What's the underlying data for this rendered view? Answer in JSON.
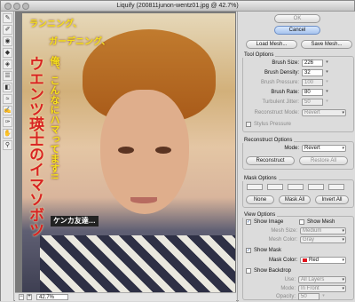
{
  "window": {
    "title": "Liquify (200811junon-wentz01.jpg @ 42.7%)"
  },
  "tools": [
    {
      "icon": "forward-warp-icon",
      "glyph": "✎"
    },
    {
      "icon": "reconstruct-icon",
      "glyph": "✐"
    },
    {
      "icon": "twirl-clockwise-icon",
      "glyph": "◉"
    },
    {
      "icon": "pucker-icon",
      "glyph": "◆"
    },
    {
      "icon": "bloat-icon",
      "glyph": "◈"
    },
    {
      "icon": "push-left-icon",
      "glyph": "☰"
    },
    {
      "icon": "mirror-icon",
      "glyph": "◧"
    },
    {
      "icon": "turbulence-icon",
      "glyph": "≈"
    },
    {
      "icon": "freeze-mask-icon",
      "glyph": "✍"
    },
    {
      "icon": "thaw-mask-icon",
      "glyph": "✑"
    },
    {
      "icon": "hand-icon",
      "glyph": "✋"
    },
    {
      "icon": "zoom-icon",
      "glyph": "⚲"
    }
  ],
  "canvas": {
    "zoom_minus": "−",
    "zoom_plus": "+",
    "zoom_value": "42.7%",
    "overlay_texts": [
      "ランニング、",
      "ガーデニング、",
      "俺、こんなにハマってます!!",
      "ウエンツ瑛士のイマソボツ",
      "ケンカ友達…"
    ]
  },
  "panel": {
    "ok": "OK",
    "cancel": "Cancel",
    "load_mesh": "Load Mesh...",
    "save_mesh": "Save Mesh...",
    "tool_options": {
      "title": "Tool Options",
      "brush_size_label": "Brush Size:",
      "brush_size": "226",
      "brush_density_label": "Brush Density:",
      "brush_density": "32",
      "brush_pressure_label": "Brush Pressure:",
      "brush_pressure": "100",
      "brush_rate_label": "Brush Rate:",
      "brush_rate": "80",
      "turbulent_jitter_label": "Turbulent Jitter:",
      "turbulent_jitter": "50",
      "reconstruct_mode_label": "Reconstruct Mode:",
      "reconstruct_mode": "Revert",
      "stylus_pressure": "Stylus Pressure"
    },
    "reconstruct_options": {
      "title": "Reconstruct Options",
      "mode_label": "Mode:",
      "mode": "Revert",
      "reconstruct": "Reconstruct",
      "restore_all": "Restore All"
    },
    "mask_options": {
      "title": "Mask Options",
      "none": "None",
      "mask_all": "Mask All",
      "invert_all": "Invert All"
    },
    "view_options": {
      "title": "View Options",
      "show_image": "Show Image",
      "show_mesh": "Show Mesh",
      "mesh_size_label": "Mesh Size:",
      "mesh_size": "Medium",
      "mesh_color_label": "Mesh Color:",
      "mesh_color": "Gray",
      "show_mask": "Show Mask",
      "mask_color_label": "Mask Color:",
      "mask_color": "Red",
      "show_backdrop": "Show Backdrop",
      "use_label": "Use:",
      "use": "All Layers",
      "mode_label": "Mode:",
      "mode": "In Front",
      "opacity_label": "Opacity:",
      "opacity": "50"
    }
  },
  "colors": {
    "mask_red": "#e0141e",
    "jp_yellow": "#f6e21c",
    "jp_red": "#d82323"
  }
}
